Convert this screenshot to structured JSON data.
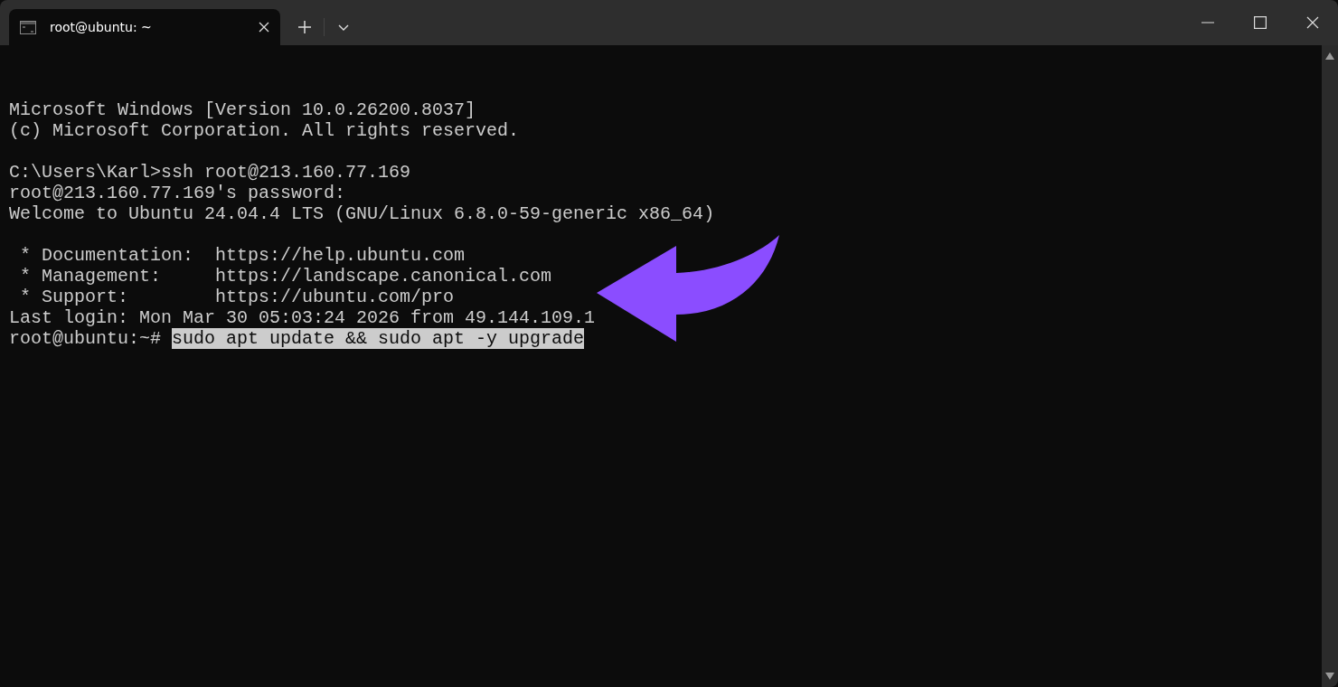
{
  "tabs": [
    {
      "title": "root@ubuntu: ~",
      "selected": true
    }
  ],
  "terminal": {
    "blocks": [
      {
        "lines": [
          "Microsoft Windows [Version 10.0.26200.8037]",
          "(c) Microsoft Corporation. All rights reserved."
        ]
      },
      {
        "lines": [
          "C:\\Users\\Karl>ssh root@213.160.77.169",
          "root@213.160.77.169's password:",
          "Welcome to Ubuntu 24.04.4 LTS (GNU/Linux 6.8.0-59-generic x86_64)"
        ]
      },
      {
        "lines": [
          " * Documentation:  https://help.ubuntu.com",
          " * Management:     https://landscape.canonical.com",
          " * Support:        https://ubuntu.com/pro",
          "Last login: Mon Mar 30 05:03:24 2026 from 49.144.109.1"
        ]
      }
    ],
    "prompt": {
      "text": "root@ubuntu:~#",
      "command": "sudo apt update && sudo apt -y upgrade",
      "selected": true
    }
  }
}
